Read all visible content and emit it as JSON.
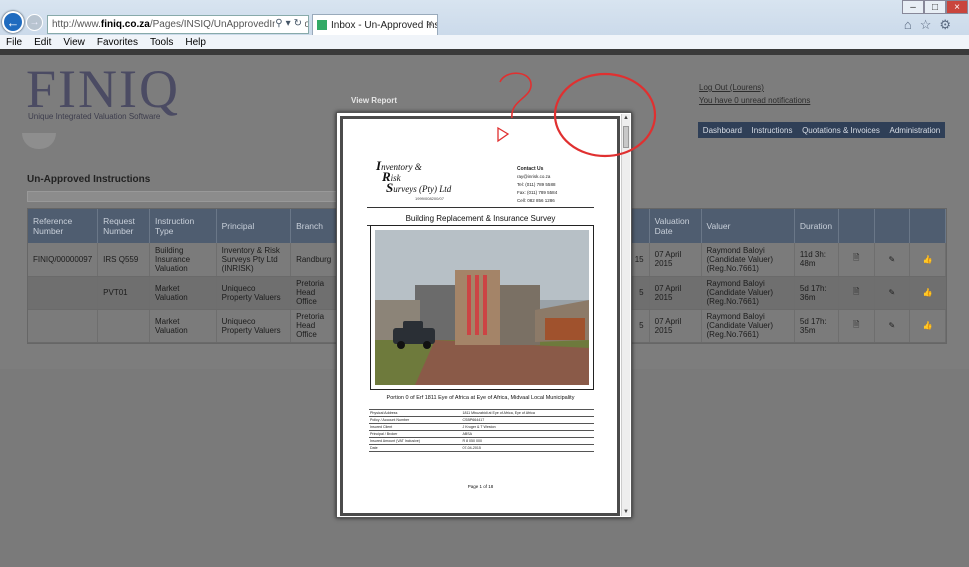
{
  "browser": {
    "address_prefix": "http://www.",
    "address_host": "finiq.co.za",
    "address_path": "/Pages/INSIQ/UnApprovedInstructions.asp",
    "tab_title": "Inbox - Un-Approved Instru...",
    "menu": [
      "File",
      "Edit",
      "View",
      "Favorites",
      "Tools",
      "Help"
    ]
  },
  "header": {
    "logo": "FINIQ",
    "tagline": "Unique Integrated Valuation Software",
    "logout": "Log Out (Lourens)",
    "notifications": "You have 0 unread notifications",
    "nav": [
      "Dashboard",
      "Instructions",
      "Quotations & Invoices",
      "Administration"
    ]
  },
  "main": {
    "section_title": "Un-Approved Instructions",
    "columns": [
      "Reference Number",
      "Request Number",
      "Instruction Type",
      "Principal",
      "Branch",
      "",
      "Valuation Date",
      "Valuer",
      "Duration",
      "",
      "",
      ""
    ],
    "rows": [
      {
        "ref": "FINIQ/00000097",
        "req": "IRS Q559",
        "type": "Building Insurance Valuation",
        "principal": "Inventory & Risk Surveys Pty Ltd (INRISK)",
        "branch": "Randburg",
        "hidden": "15",
        "date": "07 April 2015",
        "valuer": "Raymond Baloyi (Candidate Valuer) (Reg.No.7661)",
        "duration": "11d 3h: 48m"
      },
      {
        "ref": "",
        "req": "PVT01",
        "type": "Market Valuation",
        "principal": "Uniqueco Property Valuers",
        "branch": "Pretoria Head Office",
        "hidden": "5",
        "date": "07 April 2015",
        "valuer": "Raymond Baloyi (Candidate Valuer) (Reg.No.7661)",
        "duration": "5d 17h: 36m"
      },
      {
        "ref": "",
        "req": "",
        "type": "Market Valuation",
        "principal": "Uniqueco Property Valuers",
        "branch": "Pretoria Head Office",
        "hidden": "5",
        "date": "07 April 2015",
        "valuer": "Raymond Baloyi (Candidate Valuer) (Reg.No.7661)",
        "duration": "5d 17h: 35m"
      }
    ]
  },
  "modal": {
    "label": "View Report",
    "company_l1": "nventory &",
    "company_l2": "isk",
    "company_l3": "urveys (Pty) Ltd",
    "reg": "1999/008200/07",
    "contact_head": "Contact Us",
    "contact_lines": [
      "ray@inrisk.co.za",
      "Tel:     (011) 789 5588",
      "Fax:     (011) 789 5584",
      "Cell:    082 856 1286"
    ],
    "title": "Building Replacement & Insurance Survey",
    "caption": "Portion 0 of Erf 1811 Eye of Africa at Eye of Africa, Midvaal Local Municipality",
    "details": [
      [
        "Physical Address",
        "1811 Mbuzabidi at Eye of Africa, Eye of Africa"
      ],
      [
        "Policy / Account Number",
        "CSBP664417"
      ],
      [
        "Insured Client",
        "J Kruger & T Weston"
      ],
      [
        "Principal / Broker",
        "ABSA"
      ],
      [
        "Insured Amount (VAT Inclusive)",
        "R 8 050 000"
      ],
      [
        "Date",
        "07-04-2015"
      ]
    ],
    "page": "Page 1 of 18"
  },
  "annotation": {
    "mark": "?",
    "color": "#e03030"
  }
}
